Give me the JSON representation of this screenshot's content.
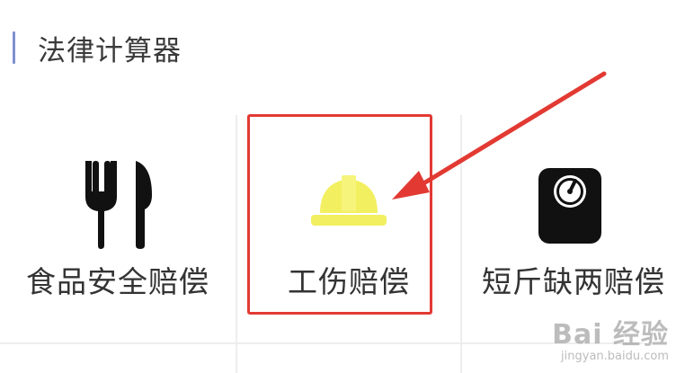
{
  "section": {
    "title": "法律计算器"
  },
  "tiles": [
    {
      "label": "食品安全赔偿",
      "icon": "fork-knife-icon"
    },
    {
      "label": "工伤赔偿",
      "icon": "hard-hat-icon"
    },
    {
      "label": "短斤缺两赔偿",
      "icon": "scale-icon"
    }
  ],
  "annotation": {
    "highlight_color": "#e23a33",
    "arrow_color": "#e23a33",
    "hard_hat_color": "#f2f060"
  },
  "watermark": {
    "main": "Bai 经验",
    "sub": "jingyan.baidu.com"
  }
}
